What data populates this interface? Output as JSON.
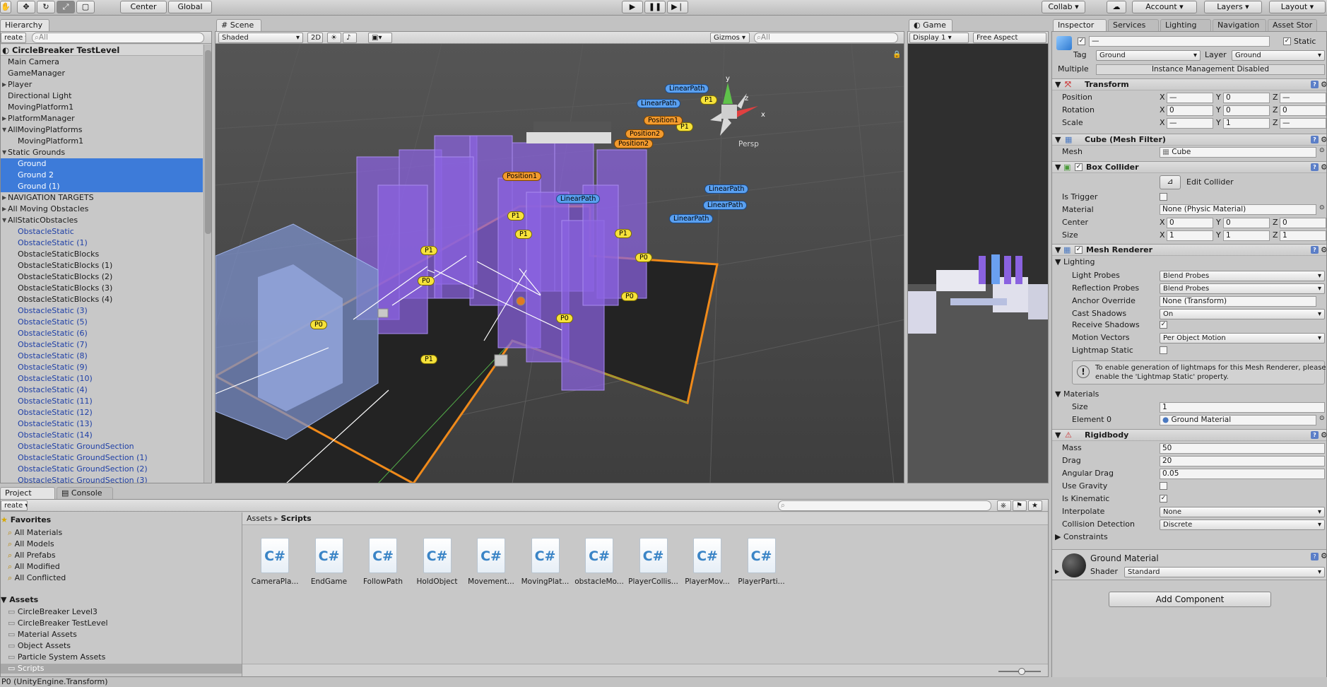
{
  "toolbar": {
    "pivot": "Center",
    "space": "Global",
    "collab": "Collab",
    "account": "Account",
    "layers": "Layers",
    "layout": "Layout"
  },
  "hierarchy": {
    "tab": "Hierarchy",
    "create": "reate",
    "search_placeholder": "All",
    "scene_name": "CircleBreaker TestLevel",
    "rows": [
      {
        "label": "Main Camera",
        "indent": 0,
        "arrow": "",
        "state": "normal"
      },
      {
        "label": "GameManager",
        "indent": 0,
        "arrow": "",
        "state": "normal"
      },
      {
        "label": "Player",
        "indent": 0,
        "arrow": "▶",
        "state": "normal"
      },
      {
        "label": "Directional Light",
        "indent": 0,
        "arrow": "",
        "state": "normal"
      },
      {
        "label": "MovingPlatform1",
        "indent": 0,
        "arrow": "",
        "state": "normal"
      },
      {
        "label": "PlatformManager",
        "indent": 0,
        "arrow": "▶",
        "state": "normal"
      },
      {
        "label": "AllMovingPlatforms",
        "indent": 0,
        "arrow": "▼",
        "state": "normal"
      },
      {
        "label": "MovingPlatform1",
        "indent": 1,
        "arrow": "",
        "state": "normal"
      },
      {
        "label": "Static Grounds",
        "indent": 0,
        "arrow": "▼",
        "state": "normal"
      },
      {
        "label": "Ground",
        "indent": 1,
        "arrow": "",
        "state": "sel"
      },
      {
        "label": "Ground 2",
        "indent": 1,
        "arrow": "",
        "state": "sel"
      },
      {
        "label": "Ground (1)",
        "indent": 1,
        "arrow": "",
        "state": "sel"
      },
      {
        "label": "NAVIGATION TARGETS",
        "indent": 0,
        "arrow": "▶",
        "state": "normal"
      },
      {
        "label": "All Moving Obstacles",
        "indent": 0,
        "arrow": "▶",
        "state": "normal"
      },
      {
        "label": "AllStaticObstacles",
        "indent": 0,
        "arrow": "▼",
        "state": "normal"
      },
      {
        "label": "ObstacleStatic",
        "indent": 1,
        "arrow": "",
        "state": "blue"
      },
      {
        "label": "ObstacleStatic (1)",
        "indent": 1,
        "arrow": "",
        "state": "blue"
      },
      {
        "label": "ObstacleStaticBlocks",
        "indent": 1,
        "arrow": "",
        "state": "normal"
      },
      {
        "label": "ObstacleStaticBlocks (1)",
        "indent": 1,
        "arrow": "",
        "state": "normal"
      },
      {
        "label": "ObstacleStaticBlocks (2)",
        "indent": 1,
        "arrow": "",
        "state": "normal"
      },
      {
        "label": "ObstacleStaticBlocks (3)",
        "indent": 1,
        "arrow": "",
        "state": "normal"
      },
      {
        "label": "ObstacleStaticBlocks (4)",
        "indent": 1,
        "arrow": "",
        "state": "normal"
      },
      {
        "label": "ObstacleStatic (3)",
        "indent": 1,
        "arrow": "",
        "state": "blue"
      },
      {
        "label": "ObstacleStatic (5)",
        "indent": 1,
        "arrow": "",
        "state": "blue"
      },
      {
        "label": "ObstacleStatic (6)",
        "indent": 1,
        "arrow": "",
        "state": "blue"
      },
      {
        "label": "ObstacleStatic (7)",
        "indent": 1,
        "arrow": "",
        "state": "blue"
      },
      {
        "label": "ObstacleStatic (8)",
        "indent": 1,
        "arrow": "",
        "state": "blue"
      },
      {
        "label": "ObstacleStatic (9)",
        "indent": 1,
        "arrow": "",
        "state": "blue"
      },
      {
        "label": "ObstacleStatic (10)",
        "indent": 1,
        "arrow": "",
        "state": "blue"
      },
      {
        "label": "ObstacleStatic (4)",
        "indent": 1,
        "arrow": "",
        "state": "blue"
      },
      {
        "label": "ObstacleStatic (11)",
        "indent": 1,
        "arrow": "",
        "state": "blue"
      },
      {
        "label": "ObstacleStatic (12)",
        "indent": 1,
        "arrow": "",
        "state": "blue"
      },
      {
        "label": "ObstacleStatic (13)",
        "indent": 1,
        "arrow": "",
        "state": "blue"
      },
      {
        "label": "ObstacleStatic (14)",
        "indent": 1,
        "arrow": "",
        "state": "blue"
      },
      {
        "label": "ObstacleStatic GroundSection",
        "indent": 1,
        "arrow": "",
        "state": "blue"
      },
      {
        "label": "ObstacleStatic GroundSection (1)",
        "indent": 1,
        "arrow": "",
        "state": "blue"
      },
      {
        "label": "ObstacleStatic GroundSection (2)",
        "indent": 1,
        "arrow": "",
        "state": "blue"
      },
      {
        "label": "ObstacleStatic GroundSection (3)",
        "indent": 1,
        "arrow": "",
        "state": "blue"
      }
    ]
  },
  "scene": {
    "tab": "Scene",
    "shading": "Shaded",
    "mode2d": "2D",
    "gizmos": "Gizmos",
    "search_placeholder": "All",
    "persp": "Persp",
    "gizmo_y": "y",
    "gizmo_z": "z",
    "gizmo_x": "x",
    "labels": {
      "p1a": "P1",
      "p1b": "P1",
      "p1c": "P1",
      "p1d": "P1",
      "p1e": "P1",
      "p1f": "P1",
      "p1g": "P1",
      "p0a": "P0",
      "p0b": "P0",
      "p0c": "P0",
      "p0d": "P0",
      "p0e": "P0",
      "pos1a": "Position1",
      "pos1b": "Position1",
      "pos2a": "Position2",
      "pos2b": "Position2",
      "lpa": "LinearPath",
      "lpb": "LinearPath",
      "lpc": "LinearPath",
      "lpd": "LinearPath",
      "lpe": "LinearPath",
      "lpf": "LinearPath"
    }
  },
  "game": {
    "tab": "Game",
    "display": "Display 1",
    "aspect": "Free Aspect"
  },
  "inspector": {
    "tabs": [
      "Inspector",
      "Services",
      "Lighting",
      "Navigation",
      "Asset Stor"
    ],
    "name_value": "—",
    "static_label": "Static",
    "tag_label": "Tag",
    "tag_value": "Ground",
    "layer_label": "Layer",
    "layer_value": "Ground",
    "multiple_label": "Multiple",
    "instance_msg": "Instance Management Disabled",
    "transform": {
      "title": "Transform",
      "rows": [
        {
          "label": "Position",
          "x": "—",
          "y": "0",
          "z": "—"
        },
        {
          "label": "Rotation",
          "x": "0",
          "y": "0",
          "z": "0"
        },
        {
          "label": "Scale",
          "x": "—",
          "y": "1",
          "z": "—"
        }
      ]
    },
    "mesh_filter": {
      "title": "Cube (Mesh Filter)",
      "mesh_label": "Mesh",
      "mesh_value": "Cube"
    },
    "box_collider": {
      "title": "Box Collider",
      "edit": "Edit Collider",
      "is_trigger": "Is Trigger",
      "material_label": "Material",
      "material_value": "None (Physic Material)",
      "center_label": "Center",
      "center": {
        "x": "0",
        "y": "0",
        "z": "0"
      },
      "size_label": "Size",
      "size": {
        "x": "1",
        "y": "1",
        "z": "1"
      }
    },
    "mesh_renderer": {
      "title": "Mesh Renderer",
      "lighting": "Lighting",
      "rows": [
        {
          "label": "Light Probes",
          "value": "Blend Probes"
        },
        {
          "label": "Reflection Probes",
          "value": "Blend Probes"
        },
        {
          "label": "Anchor Override",
          "value": "None (Transform)"
        },
        {
          "label": "Cast Shadows",
          "value": "On"
        }
      ],
      "receive_shadows": "Receive Shadows",
      "motion_vectors_label": "Motion Vectors",
      "motion_vectors_value": "Per Object Motion",
      "lightmap_static": "Lightmap Static",
      "info_line1": "To enable generation of lightmaps for this Mesh Renderer, please",
      "info_line2": "enable the 'Lightmap Static' property.",
      "materials": "Materials",
      "size_label": "Size",
      "size_value": "1",
      "element_label": "Element 0",
      "element_value": "Ground Material"
    },
    "rigidbody": {
      "title": "Rigidbody",
      "mass_label": "Mass",
      "mass": "50",
      "drag_label": "Drag",
      "drag": "20",
      "ang_label": "Angular Drag",
      "ang": "0.05",
      "gravity": "Use Gravity",
      "kinematic": "Is Kinematic",
      "interp_label": "Interpolate",
      "interp": "None",
      "coll_label": "Collision Detection",
      "coll": "Discrete",
      "constraints": "Constraints"
    },
    "material": {
      "name": "Ground Material",
      "shader_label": "Shader",
      "shader": "Standard"
    },
    "add_component": "Add Component"
  },
  "project": {
    "tab": "Project",
    "console": "Console",
    "create": "reate",
    "favorites": "Favorites",
    "fav_items": [
      "All Materials",
      "All Models",
      "All Prefabs",
      "All Modified",
      "All Conflicted"
    ],
    "assets": "Assets",
    "asset_items": [
      "CircleBreaker Level3",
      "CircleBreaker TestLevel",
      "Material Assets",
      "Object Assets",
      "Particle System Assets",
      "Scripts"
    ],
    "crumb_root": "Assets",
    "crumb_leaf": "Scripts",
    "files": [
      "CameraPla...",
      "EndGame",
      "FollowPath",
      "HoldObject",
      "Movement...",
      "MovingPlat...",
      "obstacleMo...",
      "PlayerCollis...",
      "PlayerMov...",
      "PlayerParti..."
    ]
  },
  "status": "P0 (UnityEngine.Transform)"
}
